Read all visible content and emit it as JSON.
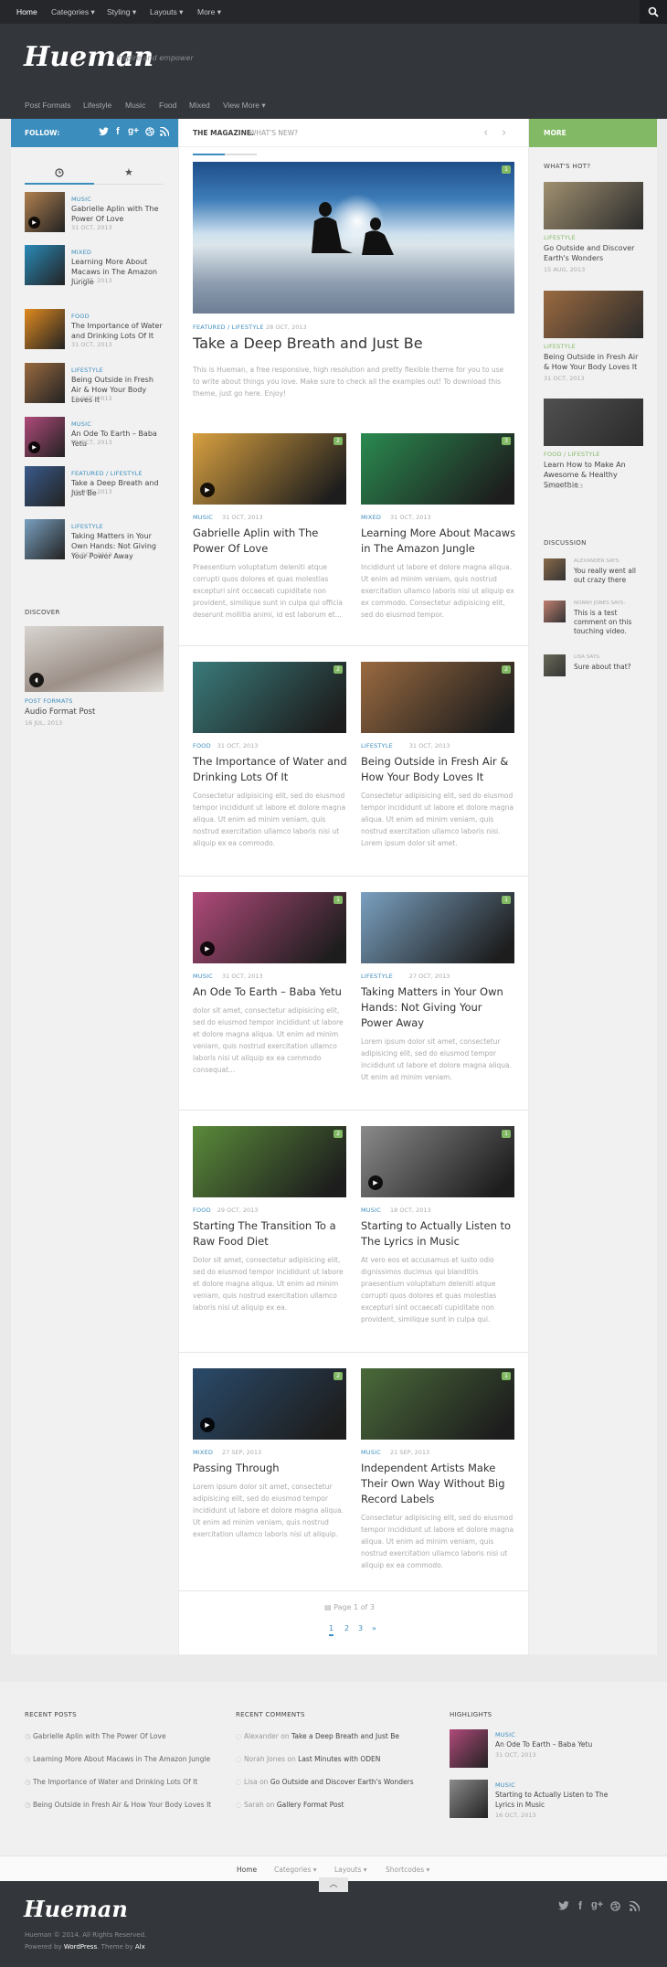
{
  "topnav": {
    "items": [
      "Home",
      "Categories ▾",
      "Styling ▾",
      "Layouts ▾",
      "More ▾"
    ],
    "search_icon": "search-icon"
  },
  "header": {
    "logo": "Hueman",
    "tagline": "Inspire and empower"
  },
  "subnav": {
    "items": [
      "Post Formats",
      "Lifestyle",
      "Music",
      "Food",
      "Mixed",
      "View More ▾"
    ]
  },
  "follow": {
    "label": "FOLLOW:",
    "icons": [
      "twitter-icon",
      "facebook-icon",
      "google-plus-icon",
      "dribbble-icon",
      "rss-icon"
    ]
  },
  "magazine": {
    "title": "THE MAGAZINE.",
    "subtitle": "WHAT'S NEW?"
  },
  "more_label": "MORE",
  "tabs": {
    "icons": [
      "clock-icon",
      "star-icon"
    ]
  },
  "left_posts": [
    {
      "cat": "MUSIC",
      "title": "Gabrielle Aplin with The Power Of Love",
      "date": "31 OCT, 2013",
      "color": "#b08050",
      "play": true
    },
    {
      "cat": "MIXED",
      "title": "Learning More About Macaws in The Amazon Jungle",
      "date": "31 OCT, 2013",
      "color": "#2a8ab8"
    },
    {
      "cat": "FOOD",
      "title": "The Importance of Water and Drinking Lots Of It",
      "date": "31 OCT, 2013",
      "color": "#e08a20"
    },
    {
      "cat": "LIFESTYLE",
      "title": "Being Outside in Fresh Air & How Your Body Loves It",
      "date": "31 OCT, 2013",
      "color": "#9a6a40"
    },
    {
      "cat": "MUSIC",
      "title": "An Ode To Earth – Baba Yetu",
      "date": "31 OCT, 2013",
      "color": "#b04a7a",
      "play": true
    },
    {
      "cat": "FEATURED / LIFESTYLE",
      "title": "Take a Deep Breath and Just Be",
      "date": "28 OCT, 2013",
      "color": "#3a5a8a"
    },
    {
      "cat": "LIFESTYLE",
      "title": "Taking Matters in Your Own Hands: Not Giving Your Power Away",
      "date": "27 OCT, 2013",
      "color": "#7aa0c0"
    }
  ],
  "discover": {
    "heading": "DISCOVER",
    "cat": "POST FORMATS",
    "title": "Audio Format Post",
    "date": "16 JUL, 2013"
  },
  "featured": {
    "cat": "FEATURED / LIFESTYLE",
    "date": "28 OCT, 2013",
    "title": "Take a Deep Breath and Just Be",
    "excerpt": "This is Hueman, a free responsive, high resolution and pretty flexible theme for you to use to write about things you love. Make sure to check all the examples out! To download this theme, just go here. Enjoy!",
    "comments": "1"
  },
  "grid_posts": [
    {
      "cat": "MUSIC",
      "date": "31 OCT, 2013",
      "title": "Gabrielle Aplin with The Power Of Love",
      "excerpt": "Praesentium voluptatum deleniti atque corrupti quos dolores et quas molestias excepturi sint occaecati cupiditate non provident, similique sunt in culpa qui officia deserunt mollitia animi, id est laborum et...",
      "color": "#d8a040",
      "play": true,
      "comments": "2"
    },
    {
      "cat": "MIXED",
      "date": "31 OCT, 2013",
      "title": "Learning More About Macaws in The Amazon Jungle",
      "excerpt": "Incididunt ut labore et dolore magna aliqua. Ut enim ad minim veniam, quis nostrud exercitation ullamco laboris nisi ut aliquip ex ex commodo. Consectetur adipisicing elit, sed do eiusmod tempor.",
      "color": "#2a8a50",
      "comments": "3"
    },
    {
      "cat": "FOOD",
      "date": "31 OCT, 2013",
      "title": "The Importance of Water and Drinking Lots Of It",
      "excerpt": "Consectetur adipisicing elit, sed do eiusmod tempor incididunt ut labore et dolore magna aliqua. Ut enim ad minim veniam, quis nostrud exercitation ullamco laboris nisi ut aliquip ex ea commodo.",
      "color": "#3a7a7a",
      "comments": "2"
    },
    {
      "cat": "LIFESTYLE",
      "date": "31 OCT, 2013",
      "title": "Being Outside in Fresh Air & How Your Body Loves It",
      "excerpt": "Consectetur adipisicing elit, sed do eiusmod tempor incididunt ut labore et dolore magna aliqua. Ut enim ad minim veniam, quis nostrud exercitation ullamco laboris nisi. Lorem ipsum dolor sit amet.",
      "color": "#9a6a40",
      "comments": "2"
    },
    {
      "cat": "MUSIC",
      "date": "31 OCT, 2013",
      "title": "An Ode To Earth – Baba Yetu",
      "excerpt": "dolor sit amet, consectetur adipisicing elit, sed do eiusmod tempor incididunt ut labore et dolore magna aliqua. Ut enim ad minim veniam, quis nostrud exercitation ullamco laboris nisi ut aliquip ex ea commodo consequat...",
      "color": "#b04a7a",
      "play": true,
      "comments": "1"
    },
    {
      "cat": "LIFESTYLE",
      "date": "27 OCT, 2013",
      "title": "Taking Matters in Your Own Hands: Not Giving Your Power Away",
      "excerpt": "Lorem ipsum dolor sit amet, consectetur adipisicing elit, sed do eiusmod tempor incididunt ut labore et dolore magna aliqua. Ut enim ad minim veniam.",
      "color": "#7aa0c0",
      "comments": "1"
    },
    {
      "cat": "FOOD",
      "date": "29 OCT, 2013",
      "title": "Starting The Transition To a Raw Food Diet",
      "excerpt": "Dolor sit amet, consectetur adipisicing elit, sed do eiusmod tempor incididunt ut labore et dolore magna aliqua. Ut enim ad minim veniam, quis nostrud exercitation ullamco laboris nisi ut aliquip ex ea.",
      "color": "#5a8a3a",
      "comments": "2"
    },
    {
      "cat": "MUSIC",
      "date": "18 OCT, 2013",
      "title": "Starting to Actually Listen to The Lyrics in Music",
      "excerpt": "At vero eos et accusamus et iusto odio dignissimos ducimus qui blanditiis praesentium voluptatum deleniti atque corrupti quos dolores et quas molestias excepturi sint occaecati cupiditate non provident, similique sunt in culpa qui.",
      "color": "#8a8a8a",
      "play": true,
      "comments": "1"
    },
    {
      "cat": "MIXED",
      "date": "27 SEP, 2013",
      "title": "Passing Through",
      "excerpt": "Lorem ipsum dolor sit amet, consectetur adipisicing elit, sed do eiusmod tempor incididunt ut labore et dolore magna aliqua. Ut enim ad minim veniam, quis nostrud exercitation ullamco laboris nisi ut aliquip.",
      "color": "#2a4a6a",
      "play": true,
      "comments": "2"
    },
    {
      "cat": "MUSIC",
      "date": "21 SEP, 2013",
      "title": "Independent Artists Make Their Own Way Without Big Record Labels",
      "excerpt": "Consectetur adipisicing elit, sed do eiusmod tempor incididunt ut labore et dolore magna aliqua. Ut enim ad minim veniam, quis nostrud exercitation ullamco laboris nisi ut aliquip ex ea commodo.",
      "color": "#4a6a3a",
      "comments": "1"
    }
  ],
  "pagination": {
    "label": "Page 1 of 3",
    "pages": [
      "1",
      "2",
      "3",
      "»"
    ]
  },
  "hot": {
    "heading": "WHAT'S HOT?",
    "items": [
      {
        "cat": "LIFESTYLE",
        "title": "Go Outside and Discover Earth's Wonders",
        "date": "15 AUG, 2013",
        "color": "#a09070"
      },
      {
        "cat": "LIFESTYLE",
        "title": "Being Outside in Fresh Air & How Your Body Loves It",
        "date": "31 OCT, 2013",
        "color": "#9a6a40"
      },
      {
        "cat": "FOOD / LIFESTYLE",
        "title": "Learn How to Make An Awesome & Healthy Smoothie",
        "date": "13 SEP, 2013",
        "color": "#505050"
      }
    ]
  },
  "discussion": {
    "heading": "DISCUSSION",
    "items": [
      {
        "who": "ALEXANDER SAYS:",
        "text": "You really went all out crazy there",
        "color": "#8a6a4a"
      },
      {
        "who": "NORAH JONES SAYS:",
        "text": "This is a test comment on this touching video.",
        "color": "#c08070"
      },
      {
        "who": "LISA SAYS:",
        "text": "Sure about that?",
        "color": "#6a6a5a"
      }
    ]
  },
  "footer": {
    "recent_posts": {
      "heading": "RECENT POSTS",
      "items": [
        "Gabrielle Aplin with The Power Of Love",
        "Learning More About Macaws in The Amazon Jungle",
        "The Importance of Water and Drinking Lots Of It",
        "Being Outside in Fresh Air & How Your Body Loves It"
      ]
    },
    "recent_comments": {
      "heading": "RECENT COMMENTS",
      "items": [
        {
          "who": "Alexander",
          "on": "on",
          "post": "Take a Deep Breath and Just Be"
        },
        {
          "who": "Norah Jones",
          "on": "on",
          "post": "Last Minutes with ODEN"
        },
        {
          "who": "Lisa",
          "on": "on",
          "post": "Go Outside and Discover Earth's Wonders"
        },
        {
          "who": "Sarah",
          "on": "on",
          "post": "Gallery Format Post"
        }
      ]
    },
    "highlights": {
      "heading": "HIGHLIGHTS",
      "items": [
        {
          "cat": "MUSIC",
          "title": "An Ode To Earth – Baba Yetu",
          "date": "31 OCT, 2013",
          "color": "#b04a7a"
        },
        {
          "cat": "MUSIC",
          "title": "Starting to Actually Listen to The Lyrics in Music",
          "date": "16 OCT, 2013",
          "color": "#8a8a8a"
        }
      ]
    },
    "nav": [
      "Home",
      "Categories ▾",
      "Layouts ▾",
      "Shortcodes ▾"
    ],
    "logo": "Hueman",
    "copyright": "Hueman © 2014. All Rights Reserved.",
    "powered_prefix": "Powered by",
    "powered_wp": "WordPress",
    "powered_theme": ". Theme by",
    "powered_alx": "Alx",
    "social": [
      "twitter-icon",
      "facebook-icon",
      "google-plus-icon",
      "dribbble-icon",
      "rss-icon"
    ]
  }
}
